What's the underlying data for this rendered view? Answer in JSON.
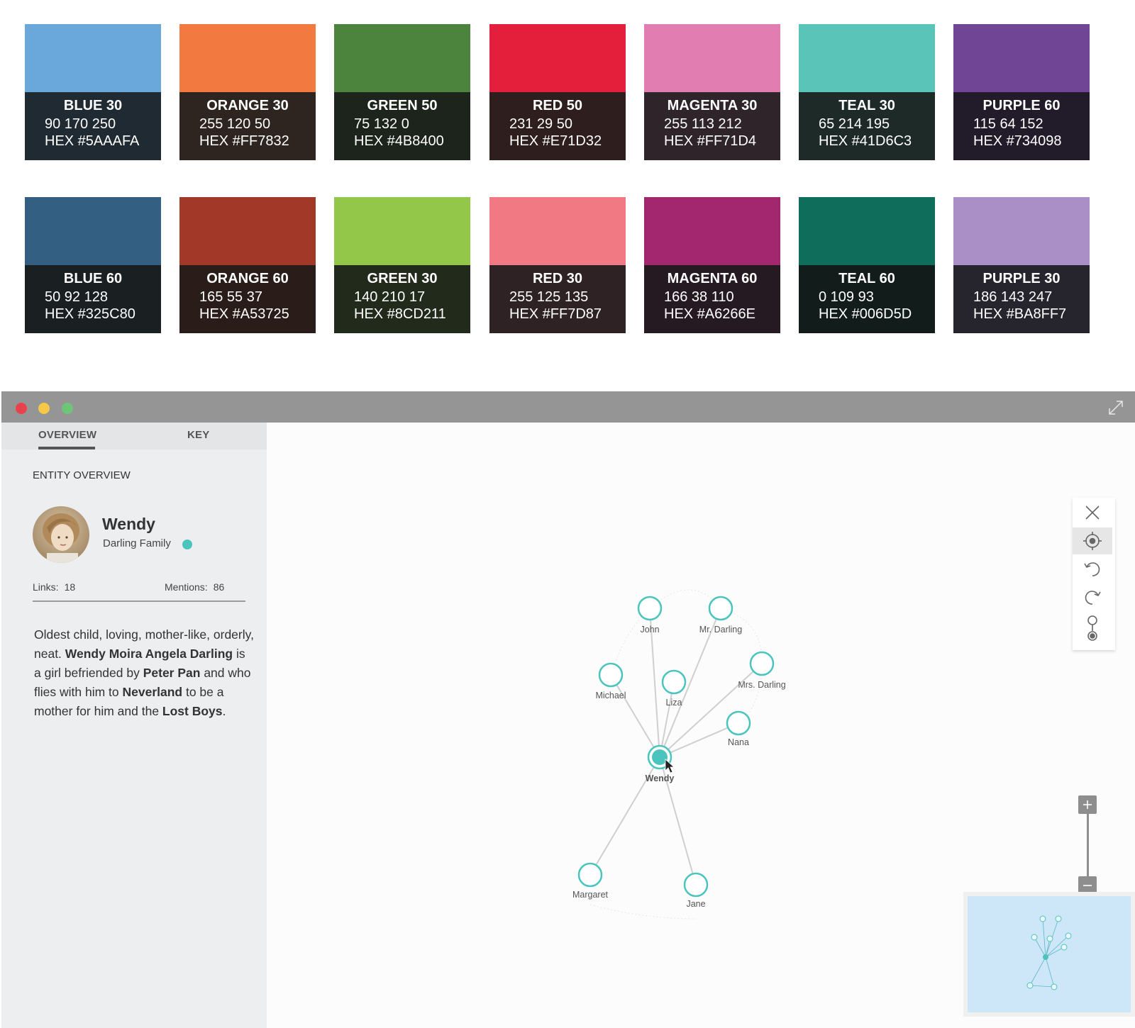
{
  "palette": [
    {
      "name": "BLUE 30",
      "rgb": "90 170 250",
      "hex": "HEX #5AAAFA",
      "swatch_color": "#6aa8dc",
      "info_bg": "#202a32"
    },
    {
      "name": "ORANGE 30",
      "rgb": "255 120 50",
      "hex": "HEX #FF7832",
      "swatch_color": "#f27a40",
      "info_bg": "#2e2420"
    },
    {
      "name": "GREEN 50",
      "rgb": "75 132 0",
      "hex": "HEX #4B8400",
      "swatch_color": "#4c843e",
      "info_bg": "#1c241c"
    },
    {
      "name": "RED 50",
      "rgb": "231 29 50",
      "hex": "HEX #E71D32",
      "swatch_color": "#e41f3b",
      "info_bg": "#2e1e1e"
    },
    {
      "name": "MAGENTA 30",
      "rgb": "255 113 212",
      "hex": "HEX #FF71D4",
      "swatch_color": "#e17db0",
      "info_bg": "#2e242a"
    },
    {
      "name": "TEAL 30",
      "rgb": "65 214 195",
      "hex": "HEX #41D6C3",
      "swatch_color": "#5bc4b8",
      "info_bg": "#1e2a28"
    },
    {
      "name": "PURPLE 60",
      "rgb": "115 64 152",
      "hex": "HEX #734098",
      "swatch_color": "#704596",
      "info_bg": "#221c2a"
    },
    {
      "name": "BLUE 60",
      "rgb": "50 92 128",
      "hex": "HEX #325C80",
      "swatch_color": "#335f82",
      "info_bg": "#1a1f22"
    },
    {
      "name": "ORANGE 60",
      "rgb": "165 55 37",
      "hex": "HEX #A53725",
      "swatch_color": "#a13828",
      "info_bg": "#2a1c18"
    },
    {
      "name": "GREEN 30",
      "rgb": "140 210 17",
      "hex": "HEX #8CD211",
      "swatch_color": "#92c74a",
      "info_bg": "#222a1c"
    },
    {
      "name": "RED 30",
      "rgb": "255 125 135",
      "hex": "HEX #FF7D87",
      "swatch_color": "#f17984",
      "info_bg": "#2e2224"
    },
    {
      "name": "MAGENTA 60",
      "rgb": "166 38 110",
      "hex": "HEX #A6266E",
      "swatch_color": "#a2276f",
      "info_bg": "#261a22"
    },
    {
      "name": "TEAL 60",
      "rgb": "0 109 93",
      "hex": "HEX #006D5D",
      "swatch_color": "#0f6d5b",
      "info_bg": "#121c1a"
    },
    {
      "name": "PURPLE 30",
      "rgb": "186 143 247",
      "hex": "HEX #BA8FF7",
      "swatch_color": "#a98fc6",
      "info_bg": "#26242c"
    }
  ],
  "window": {
    "traffic_lights": [
      "#e8434c",
      "#f5c84a",
      "#6ec577"
    ],
    "accent": "#4cc4be"
  },
  "tabs": {
    "overview": "OVERVIEW",
    "key": "KEY"
  },
  "entity": {
    "section_label": "ENTITY OVERVIEW",
    "name": "Wendy",
    "family": "Darling Family",
    "links_label": "Links:",
    "links_value": "18",
    "mentions_label": "Mentions:",
    "mentions_value": "86",
    "description": [
      {
        "t": "Oldest child, loving, mother-like, orderly, neat. ",
        "b": false
      },
      {
        "t": "Wendy Moira Angela Darling",
        "b": true
      },
      {
        "t": " is a girl befriended by ",
        "b": false
      },
      {
        "t": "Peter Pan",
        "b": true
      },
      {
        "t": " and who flies with him to ",
        "b": false
      },
      {
        "t": "Neverland",
        "b": true
      },
      {
        "t": " to be a mother for him and the ",
        "b": false
      },
      {
        "t": "Lost Boys",
        "b": true
      },
      {
        "t": ".",
        "b": false
      }
    ]
  },
  "graph": {
    "center": "Wendy",
    "nodes": [
      "John",
      "Mr. Darling",
      "Mrs. Darling",
      "Michael",
      "Liza",
      "Nana",
      "Wendy",
      "Margaret",
      "Jane"
    ]
  },
  "toolbar_icons": [
    "close-icon",
    "locate-icon",
    "undo-icon",
    "redo-icon",
    "path-icon"
  ]
}
